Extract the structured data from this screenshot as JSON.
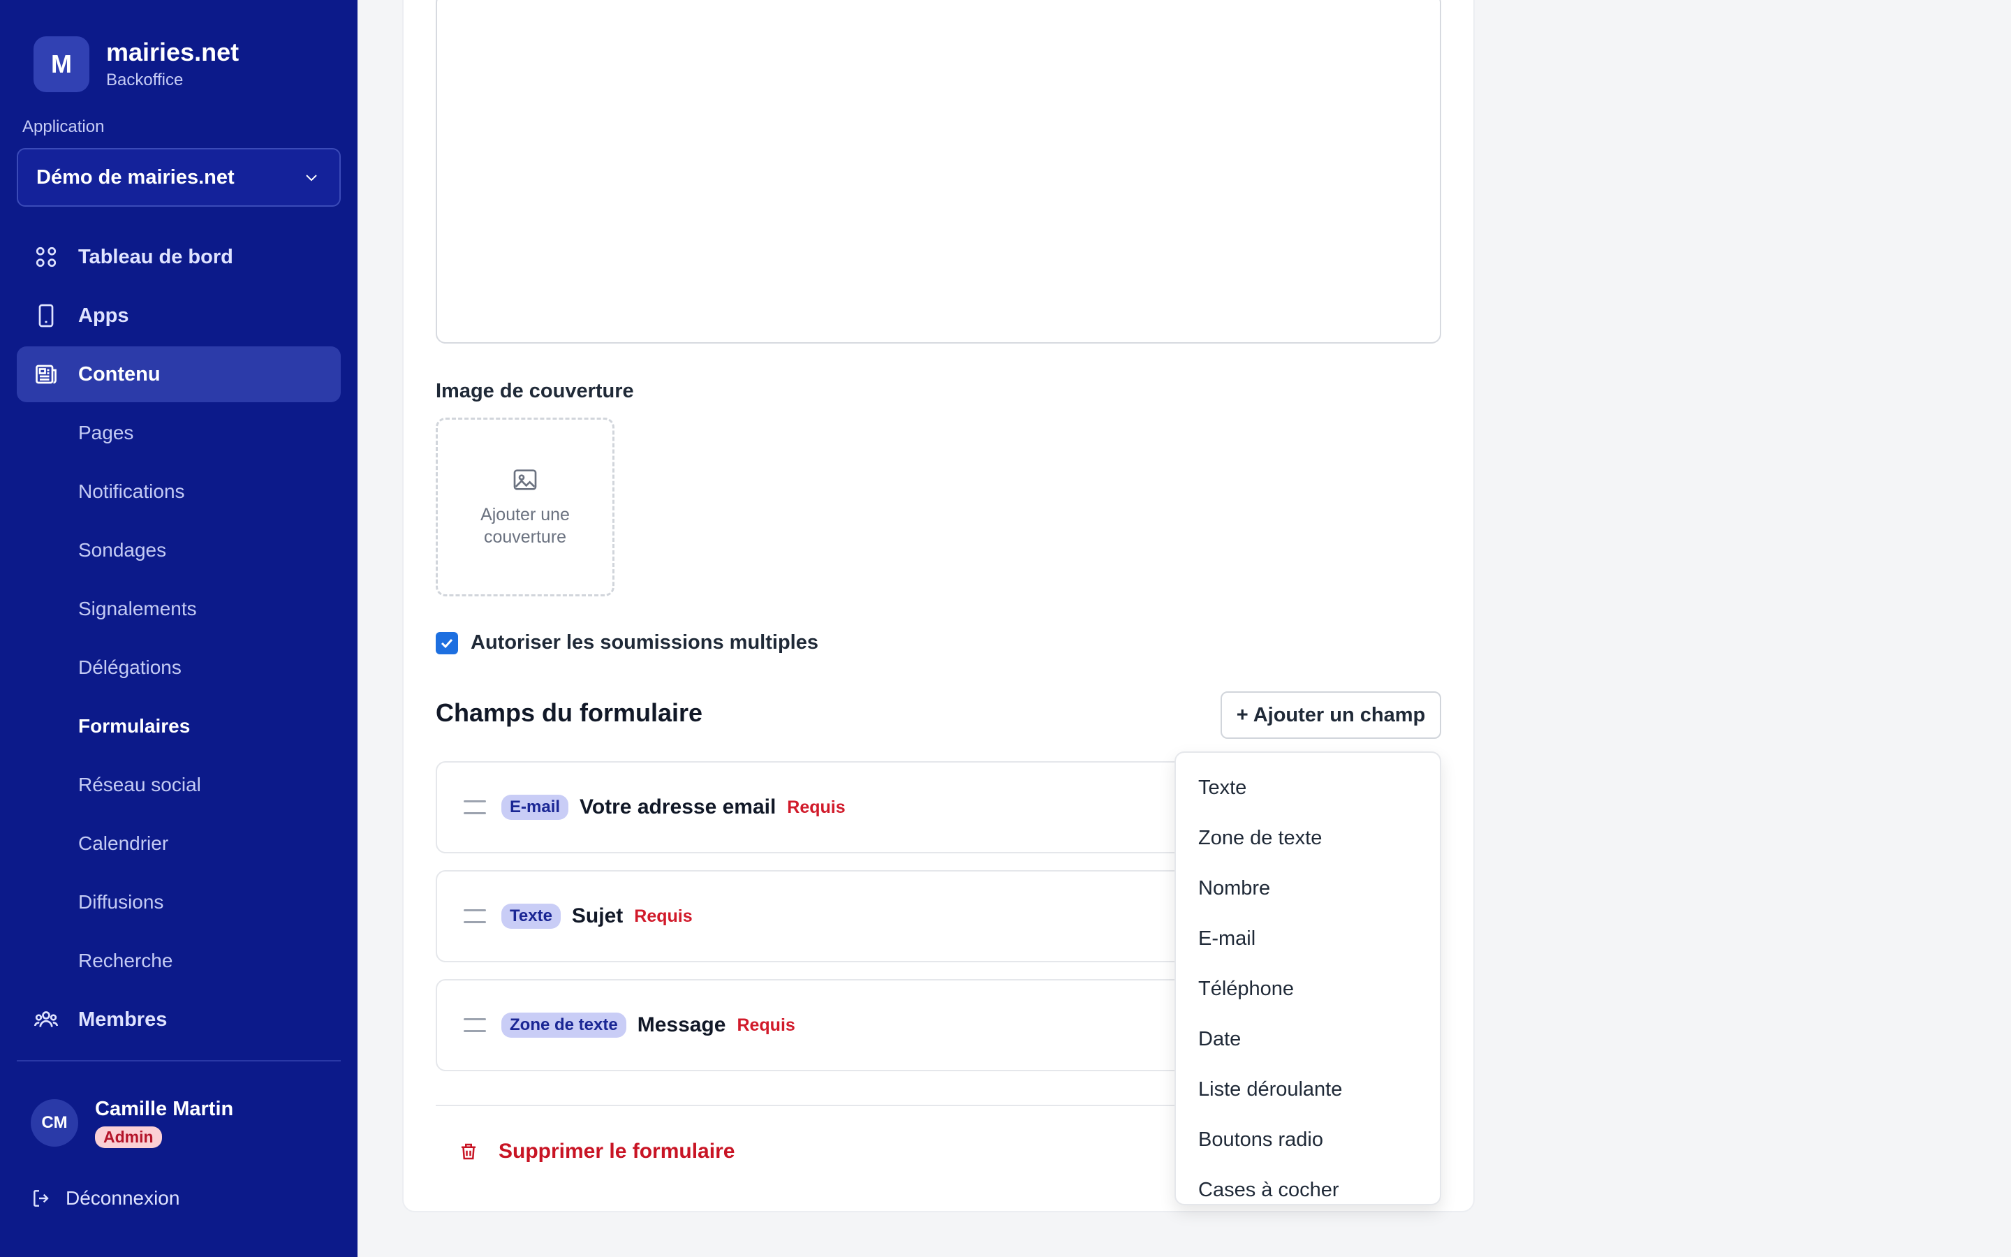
{
  "brand": {
    "logo_letter": "M",
    "name": "mairies.net",
    "subtitle": "Backoffice"
  },
  "sidebar": {
    "section_label": "Application",
    "app_select": {
      "value": "Démo de mairies.net"
    },
    "nav": [
      {
        "label": "Tableau de bord",
        "icon": "grid-icon"
      },
      {
        "label": "Apps",
        "icon": "phone-icon"
      },
      {
        "label": "Contenu",
        "icon": "newspaper-icon",
        "active": true
      }
    ],
    "contenu_items": [
      "Pages",
      "Notifications",
      "Sondages",
      "Signalements",
      "Délégations",
      "Formulaires",
      "Réseau social",
      "Calendrier",
      "Diffusions",
      "Recherche"
    ],
    "current_subitem": "Formulaires",
    "members": {
      "label": "Membres",
      "icon": "users-icon"
    },
    "user": {
      "initials": "CM",
      "name": "Camille Martin",
      "role": "Admin"
    },
    "logout": {
      "label": "Déconnexion",
      "icon": "logout-icon"
    }
  },
  "form": {
    "cover_label": "Image de couverture",
    "cover_add_line1": "Ajouter une",
    "cover_add_line2": "couverture",
    "multiple_submissions": {
      "label": "Autoriser les soumissions multiples",
      "checked": true
    },
    "fields_title": "Champs du formulaire",
    "add_field_label": "+ Ajouter un champ",
    "fields": [
      {
        "type": "E-mail",
        "label": "Votre adresse email",
        "required": "Requis"
      },
      {
        "type": "Texte",
        "label": "Sujet",
        "required": "Requis"
      },
      {
        "type": "Zone de texte",
        "label": "Message",
        "required": "Requis"
      }
    ],
    "delete_label": "Supprimer le formulaire"
  },
  "dropdown": {
    "items": [
      "Texte",
      "Zone de texte",
      "Nombre",
      "E-mail",
      "Téléphone",
      "Date",
      "Liste déroulante",
      "Boutons radio",
      "Cases à cocher"
    ]
  },
  "colors": {
    "sidebar_bg": "#0c1a8a",
    "active_bg": "#2c3ba9",
    "accent_blue": "#1d6fe0",
    "danger": "#c81424"
  }
}
